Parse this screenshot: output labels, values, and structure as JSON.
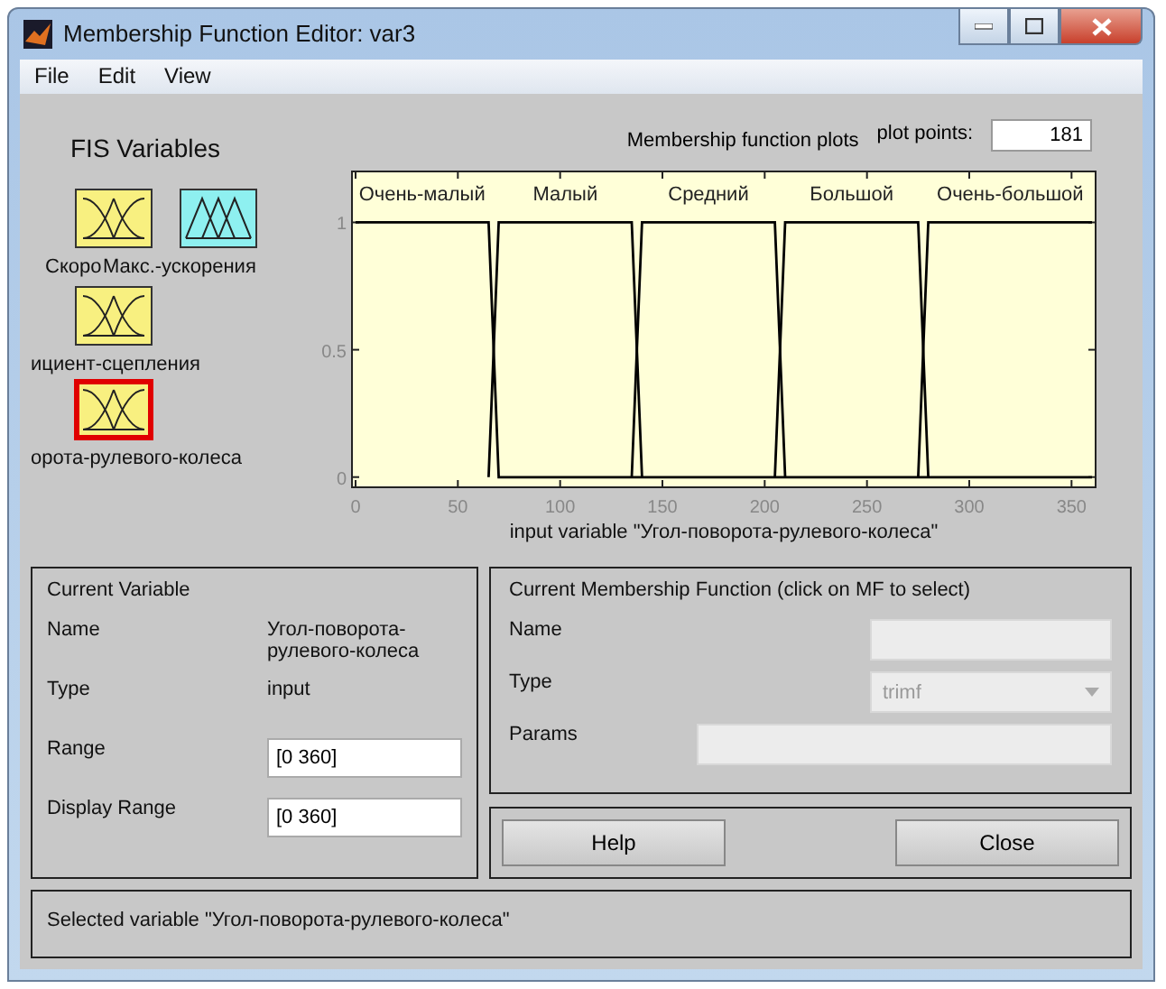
{
  "window": {
    "title": "Membership Function Editor: var3"
  },
  "menu": [
    "File",
    "Edit",
    "View"
  ],
  "fis_variables": {
    "title": "FIS Variables",
    "items": [
      {
        "label": "Скоро",
        "kind": "input",
        "selected": false
      },
      {
        "label": "Макс.-ускорения",
        "kind": "output",
        "selected": false
      },
      {
        "label": "ициент-сцепления",
        "kind": "input",
        "selected": false
      },
      {
        "label": "орота-рулевого-колеса",
        "kind": "input",
        "selected": true
      }
    ]
  },
  "plot": {
    "title": "Membership function plots",
    "plot_points_label": "plot points:",
    "plot_points": "181",
    "chart_data": {
      "type": "line",
      "xlabel": "input variable \"Угол-поворота-рулевого-колеса\"",
      "x": [
        0,
        65,
        70,
        135,
        140,
        205,
        210,
        275,
        280,
        360
      ],
      "series": [
        {
          "name": "Очень-малый",
          "color": "#000000",
          "values": [
            1,
            1,
            0,
            0,
            0,
            0,
            0,
            0,
            0,
            0
          ]
        },
        {
          "name": "Малый",
          "color": "#000000",
          "values": [
            null,
            0,
            1,
            1,
            0,
            null,
            null,
            null,
            null,
            null
          ]
        },
        {
          "name": "Средний",
          "color": "#000000",
          "values": [
            null,
            null,
            null,
            0,
            1,
            1,
            0,
            null,
            null,
            null
          ]
        },
        {
          "name": "Большой",
          "color": "#000000",
          "values": [
            null,
            null,
            null,
            null,
            null,
            0,
            1,
            1,
            0,
            null
          ]
        },
        {
          "name": "Очень-большой",
          "color": "#000000",
          "values": [
            null,
            null,
            null,
            null,
            null,
            null,
            null,
            0,
            1,
            1
          ]
        }
      ],
      "xlim": [
        0,
        360
      ],
      "ylim": [
        -0.04,
        1.2
      ],
      "xticks": [
        0,
        50,
        100,
        150,
        200,
        250,
        300,
        350
      ],
      "yticks": [
        0,
        0.5,
        1
      ]
    }
  },
  "current_variable": {
    "title": "Current Variable",
    "fields": [
      {
        "label": "Name",
        "value": "Угол-поворота-рулевого-колеса",
        "kind": "text"
      },
      {
        "label": "Type",
        "value": "input",
        "kind": "text"
      },
      {
        "label": "Range",
        "value": "[0 360]",
        "kind": "input"
      },
      {
        "label": "Display Range",
        "value": "[0 360]",
        "kind": "input"
      }
    ]
  },
  "current_mf": {
    "title": "Current Membership Function (click on MF to select)",
    "fields": [
      {
        "label": "Name",
        "kind": "input",
        "disabled": true
      },
      {
        "label": "Type",
        "value": "trimf",
        "kind": "select",
        "disabled": true
      },
      {
        "label": "Params",
        "kind": "input",
        "disabled": true
      }
    ]
  },
  "buttons": [
    "Help",
    "Close"
  ],
  "status": "Selected variable \"Угол-поворота-рулевого-колеса\""
}
